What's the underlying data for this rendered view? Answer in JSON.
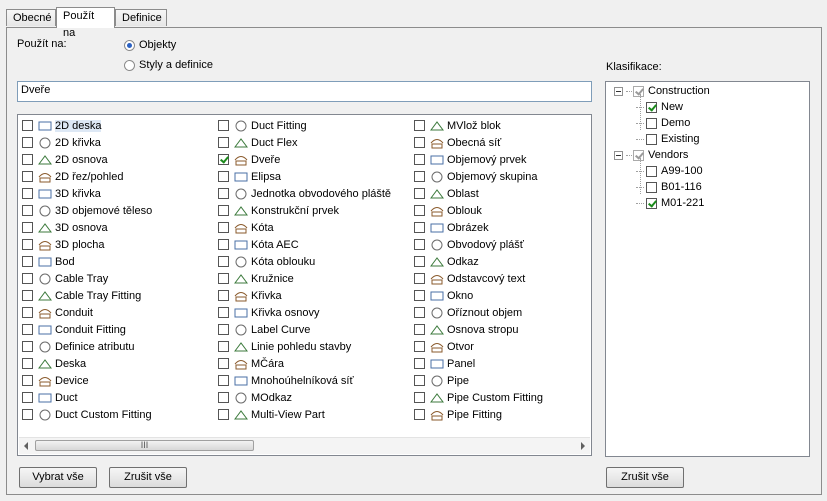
{
  "tabs": [
    "Obecné",
    "Použít na",
    "Definice"
  ],
  "apply_to_label": "Použít na:",
  "radio_objects": "Objekty",
  "radio_styles": "Styly a definice",
  "filter_value": "Dveře",
  "classification_label": "Klasifikace:",
  "columns": [
    [
      {
        "label": "2D deska",
        "checked": false,
        "icon": "2d-slab-icon",
        "selected": true
      },
      {
        "label": "2D křivka",
        "checked": false,
        "icon": "2d-curve-icon"
      },
      {
        "label": "2D osnova",
        "checked": false,
        "icon": "2d-grid-icon"
      },
      {
        "label": "2D řez/pohled",
        "checked": false,
        "icon": "section-view-icon"
      },
      {
        "label": "3D křivka",
        "checked": false,
        "icon": "3d-curve-icon"
      },
      {
        "label": "3D objemové těleso",
        "checked": false,
        "icon": "3d-solid-icon"
      },
      {
        "label": "3D osnova",
        "checked": false,
        "icon": "3d-grid-icon"
      },
      {
        "label": "3D plocha",
        "checked": false,
        "icon": "3d-face-icon"
      },
      {
        "label": "Bod",
        "checked": false,
        "icon": "point-icon"
      },
      {
        "label": "Cable Tray",
        "checked": false,
        "icon": "cable-tray-icon"
      },
      {
        "label": "Cable Tray Fitting",
        "checked": false,
        "icon": "cable-tray-fitting-icon"
      },
      {
        "label": "Conduit",
        "checked": false,
        "icon": "conduit-icon"
      },
      {
        "label": "Conduit Fitting",
        "checked": false,
        "icon": "conduit-fitting-icon"
      },
      {
        "label": "Definice atributu",
        "checked": false,
        "icon": "attribute-icon"
      },
      {
        "label": "Deska",
        "checked": false,
        "icon": "slab-icon"
      },
      {
        "label": "Device",
        "checked": false,
        "icon": "device-icon"
      },
      {
        "label": "Duct",
        "checked": false,
        "icon": "duct-icon"
      },
      {
        "label": "Duct Custom Fitting",
        "checked": false,
        "icon": "duct-custom-fitting-icon"
      }
    ],
    [
      {
        "label": "Duct Fitting",
        "checked": false,
        "icon": "duct-fitting-icon"
      },
      {
        "label": "Duct Flex",
        "checked": false,
        "icon": "duct-flex-icon"
      },
      {
        "label": "Dveře",
        "checked": true,
        "icon": "door-icon"
      },
      {
        "label": "Elipsa",
        "checked": false,
        "icon": "ellipse-icon"
      },
      {
        "label": "Jednotka obvodového pláště",
        "checked": false,
        "icon": "curtain-wall-unit-icon"
      },
      {
        "label": "Konstrukční prvek",
        "checked": false,
        "icon": "structural-member-icon"
      },
      {
        "label": "Kóta",
        "checked": false,
        "icon": "dimension-icon"
      },
      {
        "label": "Kóta AEC",
        "checked": false,
        "icon": "aec-dimension-icon"
      },
      {
        "label": "Kóta oblouku",
        "checked": false,
        "icon": "arc-dimension-icon"
      },
      {
        "label": "Kružnice",
        "checked": false,
        "icon": "circle-icon"
      },
      {
        "label": "Křivka",
        "checked": false,
        "icon": "curve-icon"
      },
      {
        "label": "Křivka osnovy",
        "checked": false,
        "icon": "grid-curve-icon"
      },
      {
        "label": "Label Curve",
        "checked": false,
        "icon": "label-curve-icon"
      },
      {
        "label": "Linie pohledu stavby",
        "checked": false,
        "icon": "building-line-icon"
      },
      {
        "label": "MČára",
        "checked": false,
        "icon": "mline-icon"
      },
      {
        "label": "Mnohoúhelníková síť",
        "checked": false,
        "icon": "polyface-mesh-icon"
      },
      {
        "label": "MOdkaz",
        "checked": false,
        "icon": "mleader-icon"
      },
      {
        "label": "Multi-View Part",
        "checked": false,
        "icon": "multiview-part-icon"
      }
    ],
    [
      {
        "label": "MVlož blok",
        "checked": false,
        "icon": "minsert-block-icon"
      },
      {
        "label": "Obecná síť",
        "checked": false,
        "icon": "mesh-icon"
      },
      {
        "label": "Objemový prvek",
        "checked": false,
        "icon": "mass-element-icon"
      },
      {
        "label": "Objemový skupina",
        "checked": false,
        "icon": "mass-group-icon"
      },
      {
        "label": "Oblast",
        "checked": false,
        "icon": "region-icon"
      },
      {
        "label": "Oblouk",
        "checked": false,
        "icon": "arc-icon"
      },
      {
        "label": "Obrázek",
        "checked": false,
        "icon": "image-icon"
      },
      {
        "label": "Obvodový plášť",
        "checked": false,
        "icon": "curtain-wall-icon"
      },
      {
        "label": "Odkaz",
        "checked": false,
        "icon": "leader-icon"
      },
      {
        "label": "Odstavcový text",
        "checked": false,
        "icon": "mtext-icon"
      },
      {
        "label": "Okno",
        "checked": false,
        "icon": "window-icon"
      },
      {
        "label": "Oříznout objem",
        "checked": false,
        "icon": "clip-volume-icon"
      },
      {
        "label": "Osnova stropu",
        "checked": false,
        "icon": "ceiling-grid-icon"
      },
      {
        "label": "Otvor",
        "checked": false,
        "icon": "opening-icon"
      },
      {
        "label": "Panel",
        "checked": false,
        "icon": "panel-icon"
      },
      {
        "label": "Pipe",
        "checked": false,
        "icon": "pipe-icon"
      },
      {
        "label": "Pipe Custom Fitting",
        "checked": false,
        "icon": "pipe-custom-fitting-icon"
      },
      {
        "label": "Pipe Fitting",
        "checked": false,
        "icon": "pipe-fitting-icon"
      }
    ]
  ],
  "scroll_thumb": "III",
  "buttons": {
    "select_all": "Vybrat vše",
    "clear_all": "Zrušit vše",
    "clear_class": "Zrušit vše"
  },
  "tree": [
    {
      "label": "Construction",
      "level": 0,
      "checked": true,
      "gray": true
    },
    {
      "label": "New",
      "level": 1,
      "checked": true
    },
    {
      "label": "Demo",
      "level": 1,
      "checked": false
    },
    {
      "label": "Existing",
      "level": 1,
      "checked": false
    },
    {
      "label": "Vendors",
      "level": 0,
      "checked": true,
      "gray": true
    },
    {
      "label": "A99-100",
      "level": 1,
      "checked": false
    },
    {
      "label": "B01-116",
      "level": 1,
      "checked": false
    },
    {
      "label": "M01-221",
      "level": 1,
      "checked": true
    }
  ]
}
